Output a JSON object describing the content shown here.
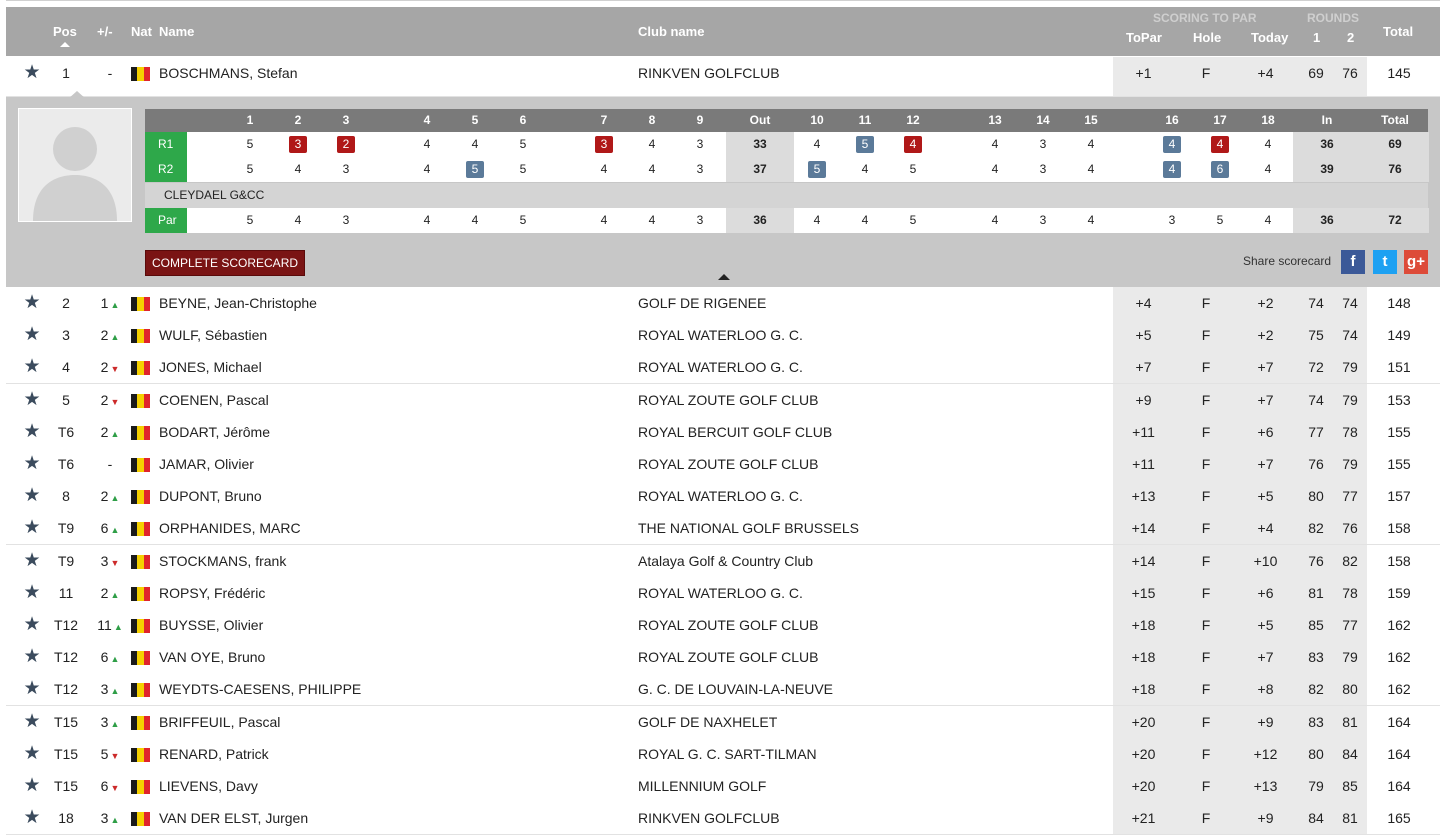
{
  "header": {
    "pos": "Pos",
    "move": "+/-",
    "nat": "Nat",
    "name": "Name",
    "club": "Club name",
    "scoring_group": "SCORING TO PAR",
    "rounds_group": "ROUNDS",
    "topar": "ToPar",
    "hole": "Hole",
    "today": "Today",
    "r1": "1",
    "r2": "2",
    "total": "Total"
  },
  "flag_colors": [
    "#1a1a1a",
    "#f5d000",
    "#e0242c"
  ],
  "players": [
    {
      "pos": "1",
      "mv": "-",
      "dir": "",
      "name": "BOSCHMANS, Stefan",
      "club": "RINKVEN GOLFCLUB",
      "topar": "+1",
      "hole": "F",
      "today": "+4",
      "r1": "69",
      "r2": "76",
      "total": "145"
    },
    {
      "pos": "2",
      "mv": "1",
      "dir": "up",
      "name": "BEYNE, Jean-Christophe",
      "club": "GOLF DE RIGENEE",
      "topar": "+4",
      "hole": "F",
      "today": "+2",
      "r1": "74",
      "r2": "74",
      "total": "148"
    },
    {
      "pos": "3",
      "mv": "2",
      "dir": "up",
      "name": "WULF, Sébastien",
      "club": "ROYAL WATERLOO G. C.",
      "topar": "+5",
      "hole": "F",
      "today": "+2",
      "r1": "75",
      "r2": "74",
      "total": "149"
    },
    {
      "pos": "4",
      "mv": "2",
      "dir": "down",
      "name": "JONES, Michael",
      "club": "ROYAL WATERLOO G. C.",
      "topar": "+7",
      "hole": "F",
      "today": "+7",
      "r1": "72",
      "r2": "79",
      "total": "151"
    },
    {
      "pos": "5",
      "mv": "2",
      "dir": "down",
      "name": "COENEN, Pascal",
      "club": "ROYAL ZOUTE GOLF CLUB",
      "topar": "+9",
      "hole": "F",
      "today": "+7",
      "r1": "74",
      "r2": "79",
      "total": "153"
    },
    {
      "pos": "T6",
      "mv": "2",
      "dir": "up",
      "name": "BODART, Jérôme",
      "club": "ROYAL BERCUIT GOLF CLUB",
      "topar": "+11",
      "hole": "F",
      "today": "+6",
      "r1": "77",
      "r2": "78",
      "total": "155"
    },
    {
      "pos": "T6",
      "mv": "-",
      "dir": "",
      "name": "JAMAR, Olivier",
      "club": "ROYAL ZOUTE GOLF CLUB",
      "topar": "+11",
      "hole": "F",
      "today": "+7",
      "r1": "76",
      "r2": "79",
      "total": "155"
    },
    {
      "pos": "8",
      "mv": "2",
      "dir": "up",
      "name": "DUPONT, Bruno",
      "club": "ROYAL WATERLOO G. C.",
      "topar": "+13",
      "hole": "F",
      "today": "+5",
      "r1": "80",
      "r2": "77",
      "total": "157"
    },
    {
      "pos": "T9",
      "mv": "6",
      "dir": "up",
      "name": "ORPHANIDES, MARC",
      "club": "THE NATIONAL GOLF BRUSSELS",
      "topar": "+14",
      "hole": "F",
      "today": "+4",
      "r1": "82",
      "r2": "76",
      "total": "158"
    },
    {
      "pos": "T9",
      "mv": "3",
      "dir": "down",
      "name": "STOCKMANS, frank",
      "club": "Atalaya Golf & Country Club",
      "topar": "+14",
      "hole": "F",
      "today": "+10",
      "r1": "76",
      "r2": "82",
      "total": "158"
    },
    {
      "pos": "11",
      "mv": "2",
      "dir": "up",
      "name": "ROPSY, Frédéric",
      "club": "ROYAL WATERLOO G. C.",
      "topar": "+15",
      "hole": "F",
      "today": "+6",
      "r1": "81",
      "r2": "78",
      "total": "159"
    },
    {
      "pos": "T12",
      "mv": "11",
      "dir": "up",
      "name": "BUYSSE, Olivier",
      "club": "ROYAL ZOUTE GOLF CLUB",
      "topar": "+18",
      "hole": "F",
      "today": "+5",
      "r1": "85",
      "r2": "77",
      "total": "162"
    },
    {
      "pos": "T12",
      "mv": "6",
      "dir": "up",
      "name": "VAN OYE, Bruno",
      "club": "ROYAL ZOUTE GOLF CLUB",
      "topar": "+18",
      "hole": "F",
      "today": "+7",
      "r1": "83",
      "r2": "79",
      "total": "162"
    },
    {
      "pos": "T12",
      "mv": "3",
      "dir": "up",
      "name": "WEYDTS-CAESENS, PHILIPPE",
      "club": "G. C. DE LOUVAIN-LA-NEUVE",
      "topar": "+18",
      "hole": "F",
      "today": "+8",
      "r1": "82",
      "r2": "80",
      "total": "162"
    },
    {
      "pos": "T15",
      "mv": "3",
      "dir": "up",
      "name": "BRIFFEUIL, Pascal",
      "club": "GOLF DE NAXHELET",
      "topar": "+20",
      "hole": "F",
      "today": "+9",
      "r1": "83",
      "r2": "81",
      "total": "164"
    },
    {
      "pos": "T15",
      "mv": "5",
      "dir": "down",
      "name": "RENARD, Patrick",
      "club": "ROYAL G. C. SART-TILMAN",
      "topar": "+20",
      "hole": "F",
      "today": "+12",
      "r1": "80",
      "r2": "84",
      "total": "164"
    },
    {
      "pos": "T15",
      "mv": "6",
      "dir": "down",
      "name": "LIEVENS, Davy",
      "club": "MILLENNIUM GOLF",
      "topar": "+20",
      "hole": "F",
      "today": "+13",
      "r1": "79",
      "r2": "85",
      "total": "164"
    },
    {
      "pos": "18",
      "mv": "3",
      "dir": "up",
      "name": "VAN DER ELST, Jurgen",
      "club": "RINKVEN GOLFCLUB",
      "topar": "+21",
      "hole": "F",
      "today": "+9",
      "r1": "84",
      "r2": "81",
      "total": "165"
    }
  ],
  "scorecard": {
    "columns": [
      "1",
      "2",
      "3",
      "4",
      "5",
      "6",
      "7",
      "8",
      "9",
      "Out",
      "10",
      "11",
      "12",
      "13",
      "14",
      "15",
      "16",
      "17",
      "18",
      "In",
      "Total"
    ],
    "rounds": [
      {
        "label": "R1",
        "scores": [
          "5",
          "3",
          "2",
          "4",
          "4",
          "5",
          "3",
          "4",
          "3",
          "33",
          "4",
          "5",
          "4",
          "4",
          "3",
          "4",
          "4",
          "4",
          "4",
          "36",
          "69"
        ],
        "marks": [
          "",
          "birdie",
          "birdie",
          "",
          "",
          "",
          "birdie",
          "",
          "",
          "",
          "",
          "bogey",
          "birdie",
          "",
          "",
          "",
          "bogey",
          "birdie",
          "",
          "",
          ""
        ]
      },
      {
        "label": "R2",
        "scores": [
          "5",
          "4",
          "3",
          "4",
          "5",
          "5",
          "4",
          "4",
          "3",
          "37",
          "5",
          "4",
          "5",
          "4",
          "3",
          "4",
          "4",
          "6",
          "4",
          "39",
          "76"
        ],
        "marks": [
          "",
          "",
          "",
          "",
          "bogey",
          "",
          "",
          "",
          "",
          "",
          "bogey",
          "",
          "",
          "",
          "",
          "",
          "bogey",
          "bogey",
          "",
          "",
          ""
        ]
      }
    ],
    "course": "CLEYDAEL G&CC",
    "par_label": "Par",
    "par": [
      "5",
      "4",
      "3",
      "4",
      "4",
      "5",
      "4",
      "4",
      "3",
      "36",
      "4",
      "4",
      "5",
      "4",
      "3",
      "4",
      "3",
      "5",
      "4",
      "36",
      "72"
    ],
    "complete_label": "COMPLETE SCORECARD",
    "share_label": "Share scorecard",
    "social": [
      {
        "icon": "facebook-icon",
        "glyph": "f",
        "color": "#3b5998"
      },
      {
        "icon": "twitter-icon",
        "glyph": "t",
        "color": "#1da1f2"
      },
      {
        "icon": "google-plus-icon",
        "glyph": "g+",
        "color": "#dd4b39"
      }
    ]
  }
}
